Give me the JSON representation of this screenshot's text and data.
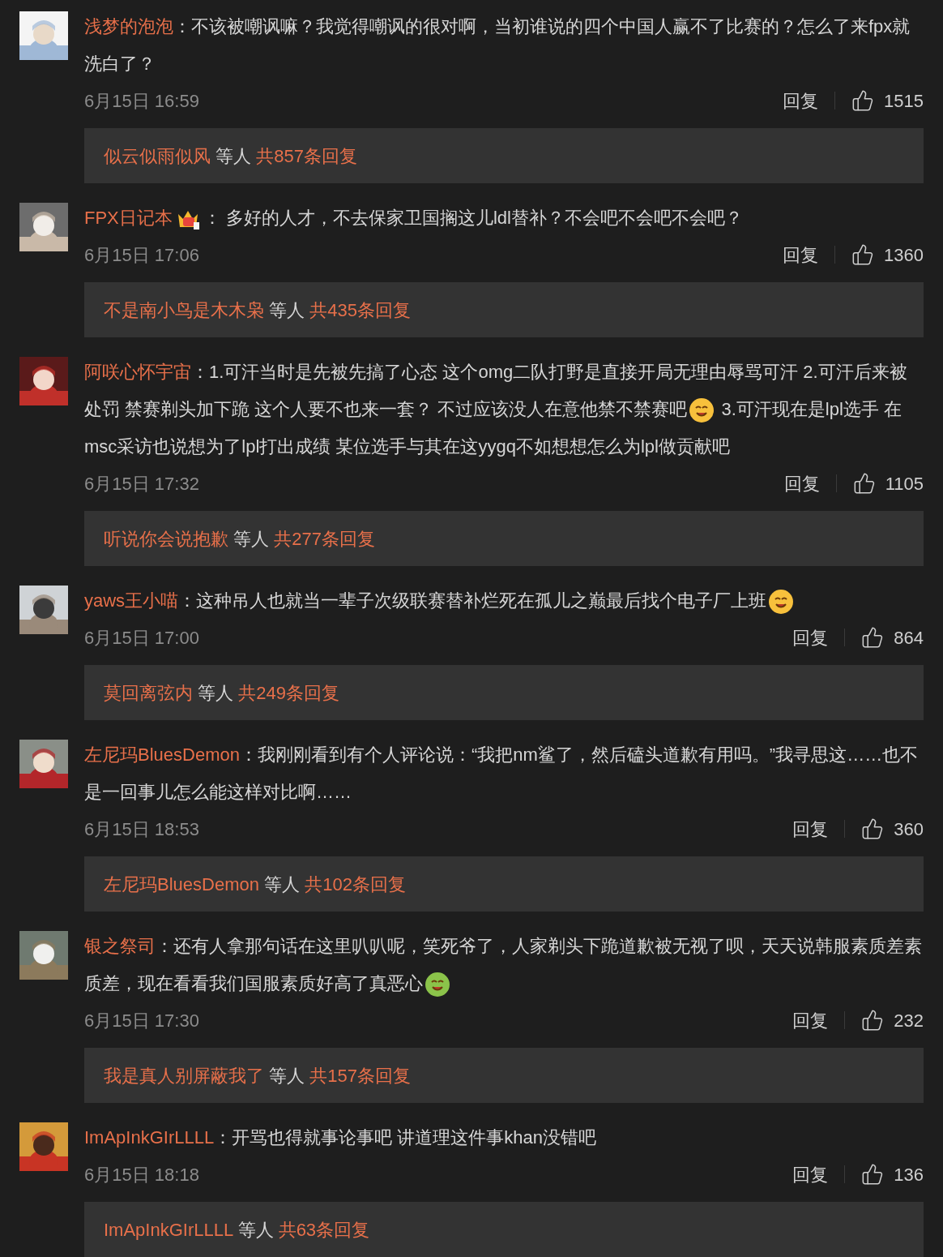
{
  "comments": [
    {
      "username": "浅梦的泡泡",
      "badge": false,
      "segments": [
        {
          "kind": "text",
          "text": "：不该被嘲讽嘛？我觉得嘲讽的很对啊，当初谁说的四个中国人赢不了比赛的？怎么了来fpx就洗白了？"
        }
      ],
      "time": "6月15日 16:59",
      "reply_label": "回复",
      "likes": "1515",
      "replies": {
        "first": "似云似雨似风",
        "middle": "等人",
        "count": "共857条回复"
      }
    },
    {
      "username": "FPX日记本",
      "badge": true,
      "segments": [
        {
          "kind": "text",
          "text": "： 多好的人才，不去保家卫国搁这儿ldl替补？不会吧不会吧不会吧？"
        }
      ],
      "time": "6月15日 17:06",
      "reply_label": "回复",
      "likes": "1360",
      "replies": {
        "first": "不是南小鸟是木木枭",
        "middle": "等人",
        "count": "共435条回复"
      }
    },
    {
      "username": "阿咲心怀宇宙",
      "badge": false,
      "segments": [
        {
          "kind": "text",
          "text": "：1.可汗当时是先被先搞了心态 这个omg二队打野是直接开局无理由辱骂可汗 2.可汗后来被处罚 禁赛剃头加下跪 这个人要不也来一套？ 不过应该没人在意他禁不禁赛吧"
        },
        {
          "kind": "emoji",
          "color": "#f7c03c"
        },
        {
          "kind": "text",
          "text": " 3.可汗现在是lpl选手 在msc采访也说想为了lpl打出成绩 某位选手与其在这yygq不如想想怎么为lpl做贡献吧"
        }
      ],
      "time": "6月15日 17:32",
      "reply_label": "回复",
      "likes": "1105",
      "replies": {
        "first": "听说你会说抱歉",
        "middle": "等人",
        "count": "共277条回复"
      }
    },
    {
      "username": "yaws王小喵",
      "badge": false,
      "segments": [
        {
          "kind": "text",
          "text": "：这种吊人也就当一辈子次级联赛替补烂死在孤儿之巅最后找个电子厂上班"
        },
        {
          "kind": "emoji",
          "color": "#f7c03c"
        }
      ],
      "time": "6月15日 17:00",
      "reply_label": "回复",
      "likes": "864",
      "replies": {
        "first": "莫回离弦内",
        "middle": "等人",
        "count": "共249条回复"
      }
    },
    {
      "username": "左尼玛BluesDemon",
      "badge": false,
      "segments": [
        {
          "kind": "text",
          "text": "：我刚刚看到有个人评论说：“我把nm鲨了，然后磕头道歉有用吗。”我寻思这……也不是一回事儿怎么能这样对比啊……"
        }
      ],
      "time": "6月15日 18:53",
      "reply_label": "回复",
      "likes": "360",
      "replies": {
        "first": "左尼玛BluesDemon",
        "middle": "等人",
        "count": "共102条回复"
      }
    },
    {
      "username": "银之祭司",
      "badge": false,
      "segments": [
        {
          "kind": "text",
          "text": "：还有人拿那句话在这里叭叭呢，笑死爷了，人家剃头下跪道歉被无视了呗，天天说韩服素质差素质差，现在看看我们国服素质好高了真恶心"
        },
        {
          "kind": "emoji",
          "color": "#8bc34a"
        }
      ],
      "time": "6月15日 17:30",
      "reply_label": "回复",
      "likes": "232",
      "replies": {
        "first": "我是真人别屏蔽我了",
        "middle": "等人",
        "count": "共157条回复"
      }
    },
    {
      "username": "ImApInkGIrLLLL",
      "badge": false,
      "segments": [
        {
          "kind": "text",
          "text": "：开骂也得就事论事吧 讲道理这件事khan没错吧"
        }
      ],
      "time": "6月15日 18:18",
      "reply_label": "回复",
      "likes": "136",
      "replies": {
        "first": "ImApInkGIrLLLL",
        "middle": "等人",
        "count": "共63条回复"
      }
    }
  ]
}
